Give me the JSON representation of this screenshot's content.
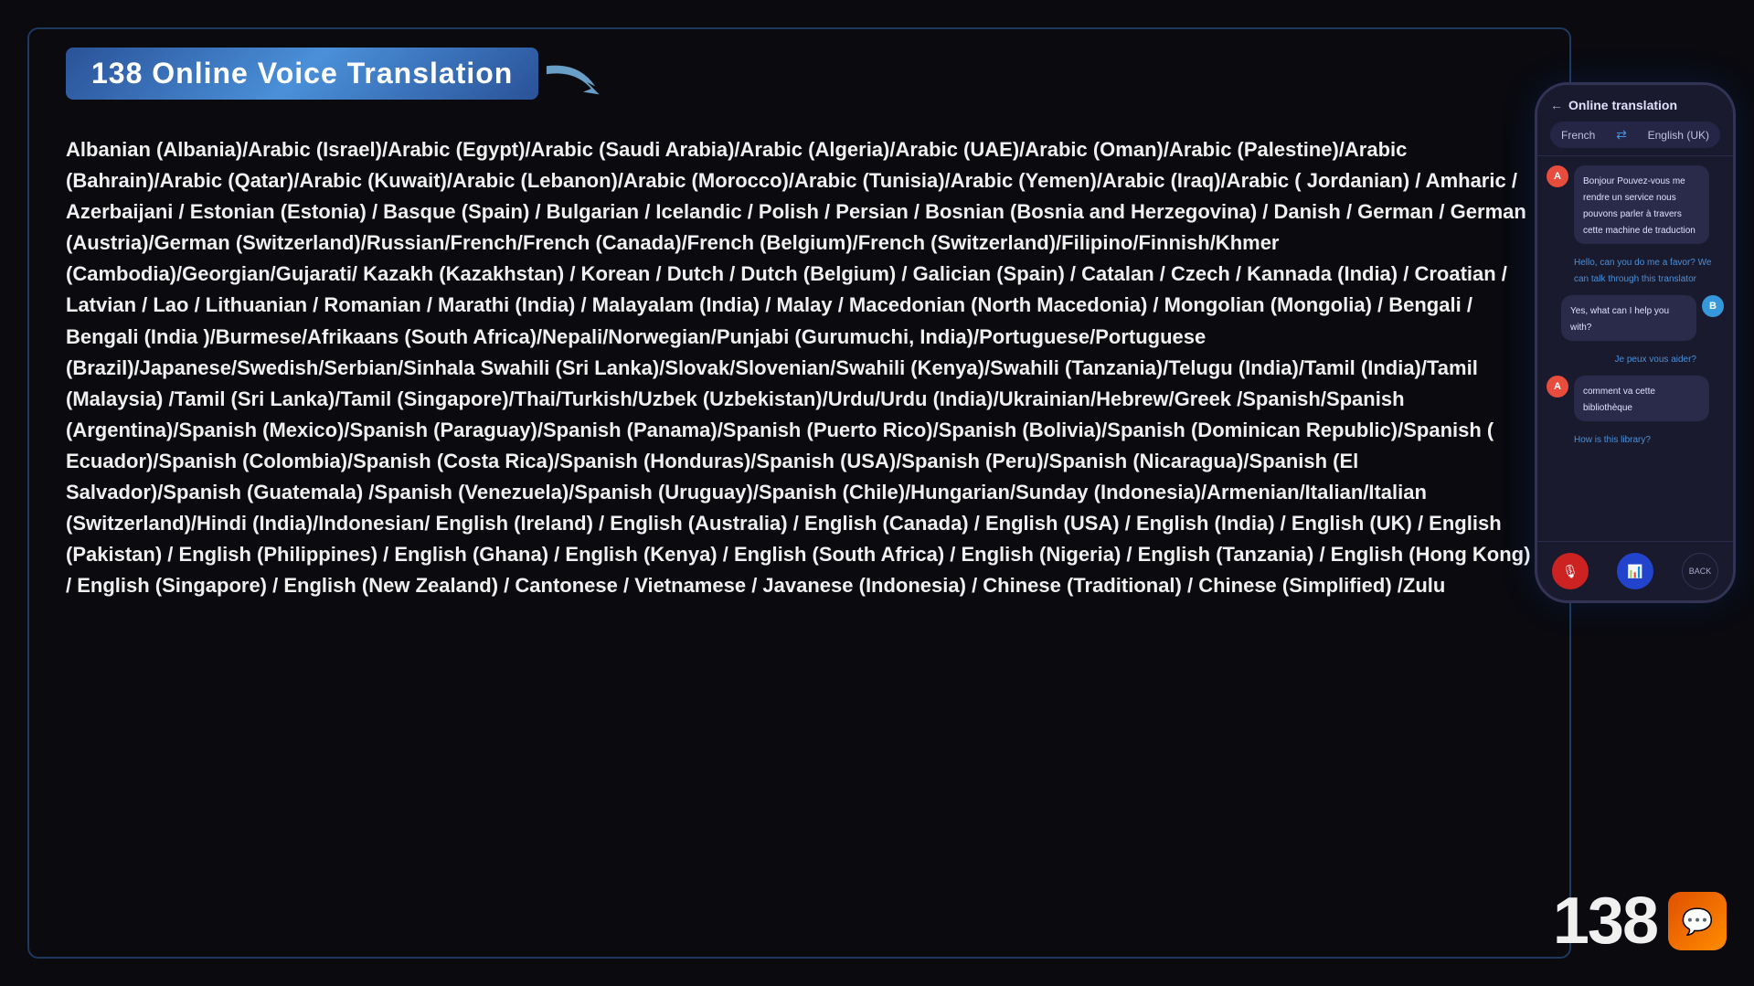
{
  "title": "138 Online Voice Translation",
  "languages_text": "Albanian (Albania)/Arabic (Israel)/Arabic (Egypt)/Arabic (Saudi Arabia)/Arabic (Algeria)/Arabic (UAE)/Arabic (Oman)/Arabic (Palestine)/Arabic (Bahrain)/Arabic (Qatar)/Arabic (Kuwait)/Arabic (Lebanon)/Arabic (Morocco)/Arabic (Tunisia)/Arabic (Yemen)/Arabic (Iraq)/Arabic ( Jordanian) / Amharic / Azerbaijani / Estonian (Estonia) / Basque (Spain) / Bulgarian / Icelandic / Polish / Persian / Bosnian (Bosnia and Herzegovina) / Danish / German / German (Austria)/German (Switzerland)/Russian/French/French (Canada)/French (Belgium)/French (Switzerland)/Filipino/Finnish/Khmer (Cambodia)/Georgian/Gujarati/ Kazakh (Kazakhstan) / Korean / Dutch / Dutch (Belgium) / Galician (Spain) / Catalan / Czech / Kannada (India) / Croatian / Latvian / Lao / Lithuanian / Romanian / Marathi (India) / Malayalam (India) / Malay / Macedonian (North Macedonia) / Mongolian (Mongolia) / Bengali / Bengali (India )/Burmese/Afrikaans (South Africa)/Nepali/Norwegian/Punjabi (Gurumuchi, India)/Portuguese/Portuguese (Brazil)/Japanese/Swedish/Serbian/Sinhala Swahili (Sri Lanka)/Slovak/Slovenian/Swahili (Kenya)/Swahili (Tanzania)/Telugu (India)/Tamil (India)/Tamil (Malaysia) /Tamil (Sri Lanka)/Tamil (Singapore)/Thai/Turkish/Uzbek (Uzbekistan)/Urdu/Urdu (India)/Ukrainian/Hebrew/Greek /Spanish/Spanish (Argentina)/Spanish (Mexico)/Spanish (Paraguay)/Spanish (Panama)/Spanish (Puerto Rico)/Spanish (Bolivia)/Spanish (Dominican Republic)/Spanish ( Ecuador)/Spanish (Colombia)/Spanish (Costa Rica)/Spanish (Honduras)/Spanish (USA)/Spanish (Peru)/Spanish (Nicaragua)/Spanish (El Salvador)/Spanish (Guatemala) /Spanish (Venezuela)/Spanish (Uruguay)/Spanish (Chile)/Hungarian/Sunday (Indonesia)/Armenian/Italian/Italian (Switzerland)/Hindi (India)/Indonesian/ English (Ireland) / English (Australia) / English (Canada) / English (USA) / English (India) / English (UK) / English (Pakistan) / English (Philippines) / English (Ghana) / English (Kenya) / English (South Africa) / English (Nigeria) / English (Tanzania) / English (Hong Kong) / English (Singapore) / English (New Zealand) / Cantonese / Vietnamese / Javanese (Indonesia) / Chinese (Traditional) / Chinese (Simplified) /Zulu",
  "phone": {
    "header_title": "Online translation",
    "lang_from": "French",
    "lang_to": "English (UK)",
    "messages": [
      {
        "side": "left",
        "avatar": "A",
        "original": "Bonjour Pouvez-vous me rendre un service nous pouvons parler à travers cette machine de traduction",
        "translation": "Hello, can you do me a favor? We can talk through this translator"
      },
      {
        "side": "right",
        "avatar": "B",
        "original": "Yes, what can I help you with?",
        "translation": "Je peux vous aider?"
      },
      {
        "side": "left",
        "avatar": "A",
        "original": "comment va cette bibliothèque",
        "translation": "How is this library?"
      }
    ],
    "controls": [
      {
        "icon": "🎤",
        "color": "red"
      },
      {
        "icon": "📊",
        "color": "blue"
      },
      {
        "label": "BACK",
        "color": "dark"
      }
    ]
  },
  "branding": {
    "number": "138",
    "icon": "💬"
  }
}
